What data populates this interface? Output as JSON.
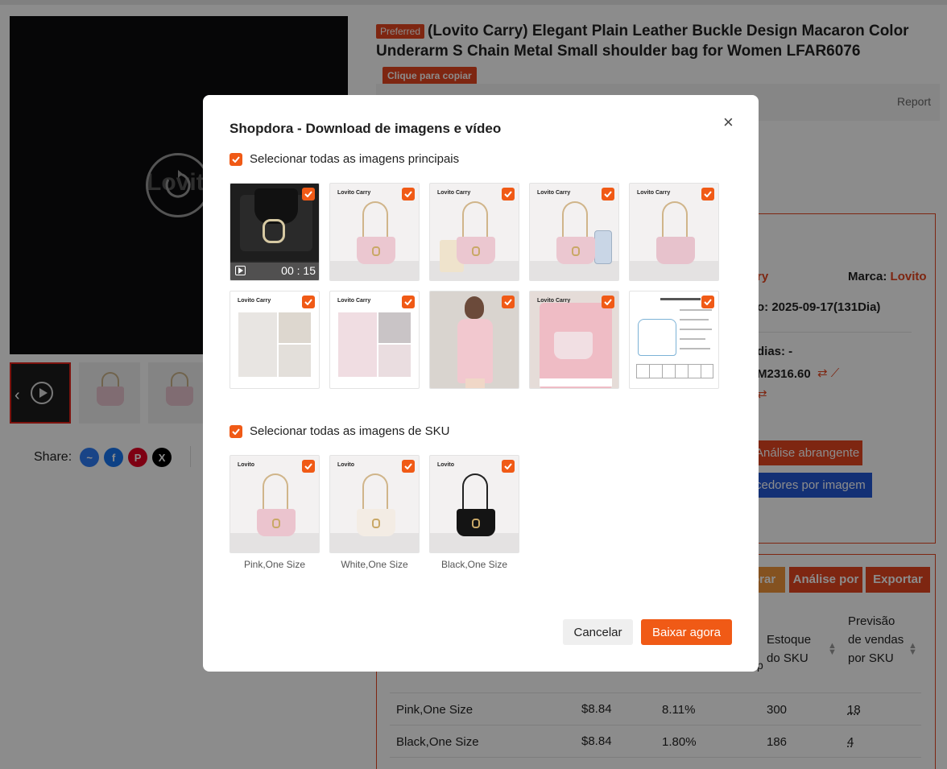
{
  "page": {
    "preferred_badge": "Preferred",
    "product_title": "(Lovito Carry) Elegant Plain Leather Buckle Design Macaron Color Underarm S Chain Metal Small shoulder bag for Women LFAR6076",
    "copy_button": "Clique para copiar",
    "report": "Report",
    "video_watermark": "Lovito",
    "share_label": "Share:",
    "share_icons": [
      "messenger-icon",
      "facebook-icon",
      "pinterest-icon",
      "x-icon"
    ],
    "brand_label": "Marca:",
    "brand_value": "Lovito",
    "partial_ry": "ry",
    "date_text": "o: 2025-09-17(131Dia)",
    "dias_text": "dias: -",
    "amount_text": "M2316.60",
    "btn_analise": "Análise abrangente",
    "btn_fornecedores": "cedores por imagem",
    "btn_orar": "orar",
    "btn_analise_por": "Análise por",
    "btn_exportar": "Exportar",
    "col_estoque": "Estoque do SKU",
    "col_previsao": "Previsão de vendas por SKU",
    "col_partial_p": "p",
    "rows": [
      {
        "name": "Pink,One Size",
        "price": "$8.84",
        "pct": "8.11%",
        "stock": "300",
        "forecast": "18"
      },
      {
        "name": "Black,One Size",
        "price": "$8.84",
        "pct": "1.80%",
        "stock": "186",
        "forecast": "4"
      }
    ]
  },
  "modal": {
    "title": "Shopdora - Download de imagens e vídeo",
    "select_main_label": "Selecionar todas as imagens principais",
    "select_sku_label": "Selecionar todas as imagens de SKU",
    "video_duration": "00 : 15",
    "main_images_brand": "Lovito Carry",
    "sku_images_brand": "Lovito",
    "sku_labels": [
      "Pink,One Size",
      "White,One Size",
      "Black,One Size"
    ],
    "cancel_label": "Cancelar",
    "download_label": "Baixar agora"
  },
  "colors": {
    "accent": "#f05a16",
    "brand_red": "#e5451f",
    "blue_button": "#2458d6"
  }
}
